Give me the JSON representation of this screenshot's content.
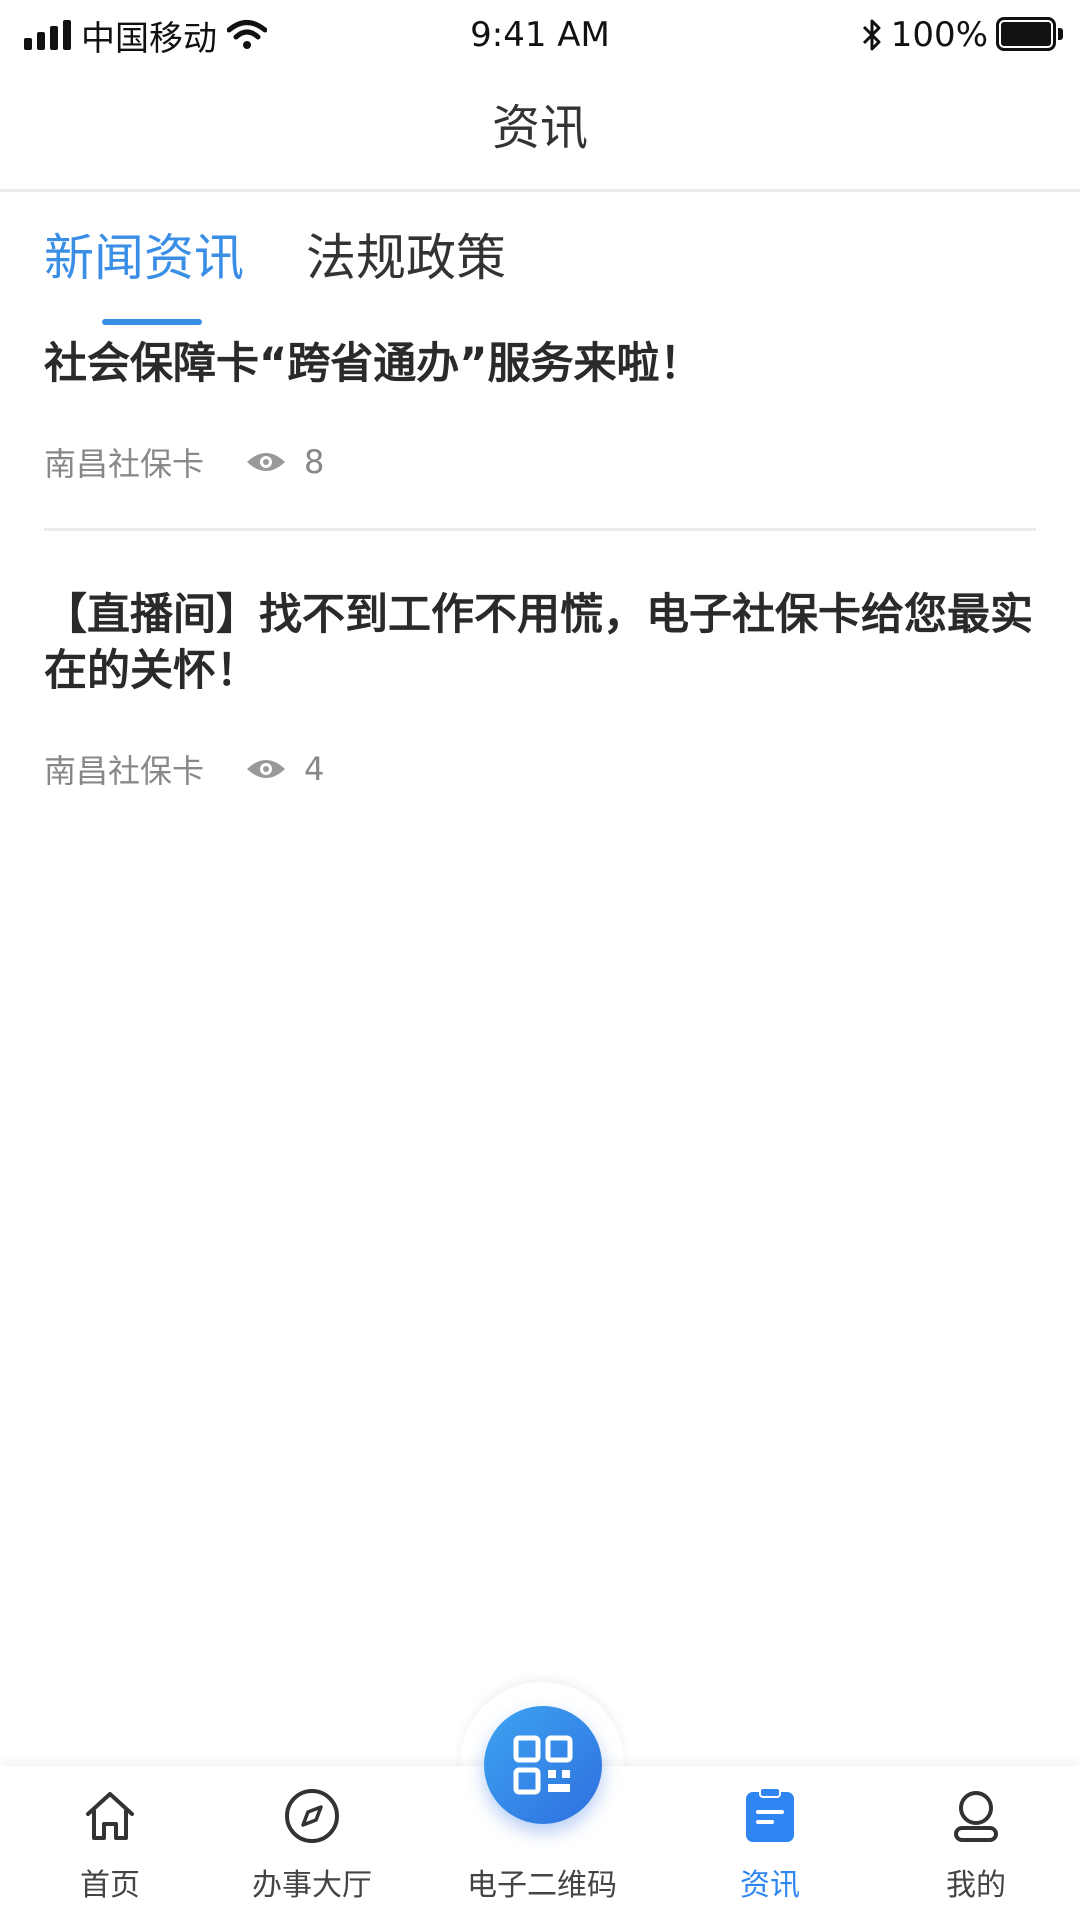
{
  "status_bar": {
    "carrier": "中国移动",
    "time": "9:41 AM",
    "battery": "100%"
  },
  "navbar": {
    "title": "资讯"
  },
  "tabs": [
    {
      "label": "新闻资讯",
      "active": true
    },
    {
      "label": "法规政策",
      "active": false
    }
  ],
  "news": [
    {
      "title": "社会保障卡“跨省通办”服务来啦！",
      "source": "南昌社保卡",
      "views": "8"
    },
    {
      "title": "【直播间】找不到工作不用慌，电子社保卡给您最实在的关怀！",
      "source": "南昌社保卡",
      "views": "4"
    }
  ],
  "tabbar": {
    "items": [
      {
        "label": "首页",
        "icon": "home-icon",
        "active": false
      },
      {
        "label": "办事大厅",
        "icon": "compass-icon",
        "active": false
      },
      {
        "label": "电子二维码",
        "icon": "qr-code-icon",
        "active": false
      },
      {
        "label": "资讯",
        "icon": "news-clipboard-icon",
        "active": true
      },
      {
        "label": "我的",
        "icon": "user-icon",
        "active": false
      }
    ]
  },
  "colors": {
    "accent": "#3a8ee6",
    "tab_active": "#2f86f2",
    "qr_gradient_start": "#3ea4f0",
    "qr_gradient_end": "#2e6fe0"
  }
}
